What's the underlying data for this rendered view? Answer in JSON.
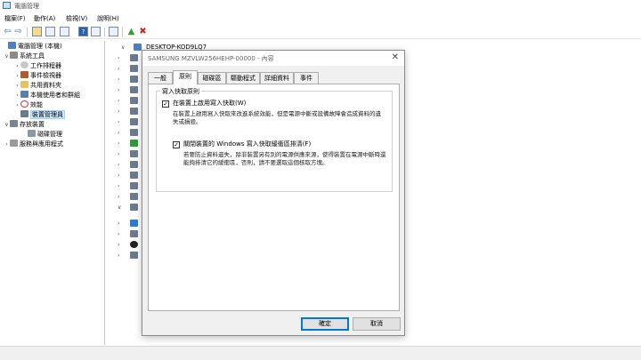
{
  "window": {
    "title": "電腦管理"
  },
  "menu": [
    "檔案(F)",
    "動作(A)",
    "檢視(V)",
    "說明(H)"
  ],
  "toolbar": {
    "back_icon": "back-arrow-icon",
    "forward_icon": "forward-arrow-icon",
    "delete_icon": "delete-x-icon",
    "colors": {
      "back_forward": "#2b7bd6",
      "delete": "#e02020",
      "scan": "#3a9a3a"
    }
  },
  "tree": {
    "root": "電腦管理 (本機)",
    "system_tools": "系統工具",
    "task_scheduler": "工作排程器",
    "event_viewer": "事件檢視器",
    "shared_folders": "共用資料夾",
    "local_users": "本機使用者和群組",
    "performance": "效能",
    "device_manager": "裝置管理員",
    "storage": "存放裝置",
    "disk_management": "磁碟管理",
    "services_apps": "服務與應用程式"
  },
  "device_list": {
    "computer_name": "DESKTOP-KOD9LQ7"
  },
  "dialog": {
    "title": "SAMSUNG MZVLW256HEHP-00000 - 內容",
    "tabs": [
      "一般",
      "原則",
      "磁碟區",
      "驅動程式",
      "詳細資料",
      "事件"
    ],
    "active_tab": "原則",
    "group_title": "寫入快取原則",
    "option1_label": "在裝置上啟用寫入快取(W)",
    "option1_checked": true,
    "option1_desc": "在裝置上啟用寫入快取來改進系統效能，但是電源中斷或設備故障會造成資料的遺失或損毀。",
    "option2_label": "關閉裝置的 Windows 寫入快取緩衝區排清(F)",
    "option2_checked": true,
    "option2_desc": "若要防止資料遺失，除非裝置另有別的電源供應來源，使得裝置在電源中斷時還能夠排清它的緩衝區，否則，請不要選取這個核取方塊。",
    "ok_label": "確定",
    "cancel_label": "取消"
  }
}
